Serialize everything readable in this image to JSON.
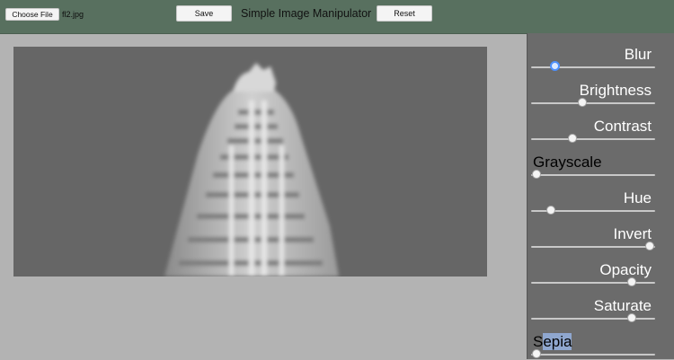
{
  "toolbar": {
    "choose_file_label": "Choose File",
    "file_name": "fl2.jpg",
    "save_label": "Save",
    "title": "Simple Image Manipulator",
    "reset_label": "Reset"
  },
  "controls": [
    {
      "label": "Blur",
      "value": 0.19,
      "focused": true
    },
    {
      "label": "Brightness",
      "value": 0.41
    },
    {
      "label": "Contrast",
      "value": 0.33
    },
    {
      "label": "Grayscale",
      "value": 0.04
    },
    {
      "label": "Hue",
      "value": 0.16
    },
    {
      "label": "Invert",
      "value": 0.96
    },
    {
      "label": "Opacity",
      "value": 0.81
    },
    {
      "label": "Saturate",
      "value": 0.81
    },
    {
      "label": "Sepia",
      "value": 0.04
    }
  ],
  "colors": {
    "toolbar_bg": "#58705f",
    "panel_bg": "#6b6b6b",
    "canvas_bg": "#666666",
    "page_bg": "#b3b3b3"
  }
}
